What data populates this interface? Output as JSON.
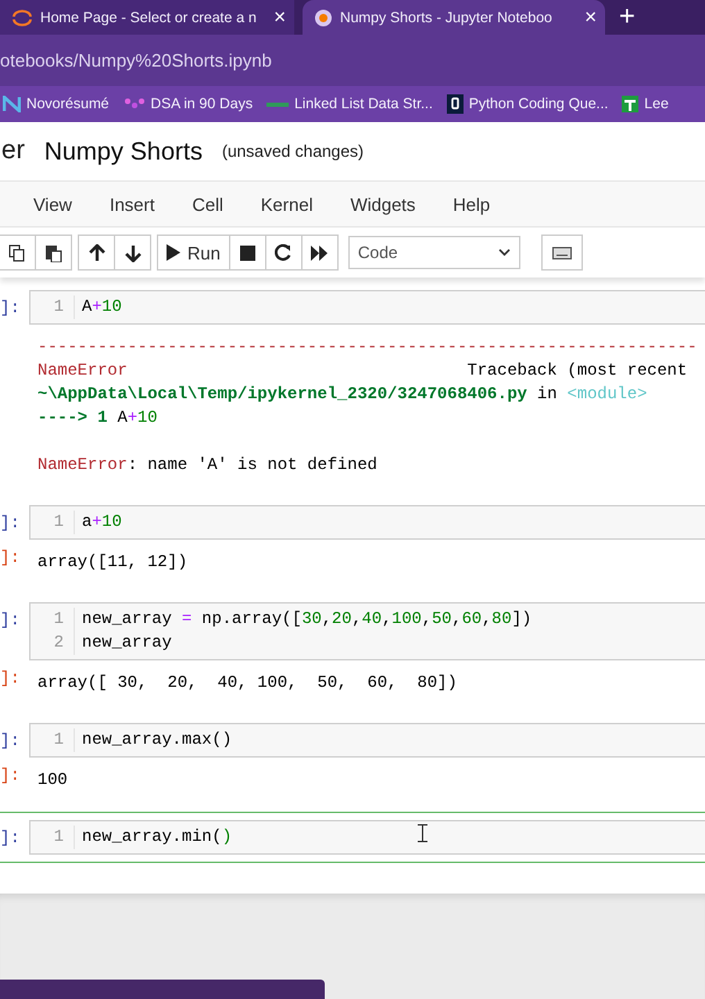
{
  "browser": {
    "tabs": [
      {
        "title": "Home Page - Select or create a n",
        "selected": false,
        "close": "×"
      },
      {
        "title": "Numpy Shorts - Jupyter Noteboo",
        "selected": true,
        "close": "×"
      }
    ],
    "new_tab": "+",
    "address": "otebooks/Numpy%20Shorts.ipynb",
    "bookmarks": [
      {
        "label": "Novorésumé",
        "kind": "n"
      },
      {
        "label": "DSA in 90 Days",
        "kind": "dots"
      },
      {
        "label": "Linked List Data Str...",
        "kind": "line"
      },
      {
        "label": "Python Coding Que...",
        "kind": "q"
      },
      {
        "label": "Lee",
        "kind": "plus"
      }
    ]
  },
  "notebook": {
    "logo_fragment": "er",
    "title": "Numpy Shorts",
    "status": "(unsaved changes)",
    "menu": [
      "View",
      "Insert",
      "Cell",
      "Kernel",
      "Widgets",
      "Help"
    ],
    "toolbar": {
      "run": "Run",
      "cell_type": "Code"
    },
    "cells": [
      {
        "prompt": "]:",
        "selected": false,
        "lines": [
          {
            "number": "1",
            "tokens": [
              {
                "text": "A",
                "kind": "plain"
              },
              {
                "text": "+",
                "kind": "op"
              },
              {
                "text": "10",
                "kind": "num"
              }
            ]
          }
        ],
        "output": [
          [
            {
              "text": "------------------------------------------------------------------",
              "kind": "err"
            }
          ],
          [
            {
              "text": "NameError",
              "kind": "err"
            },
            {
              "text": "                                  Traceback (most recent",
              "kind": "plain"
            }
          ],
          [
            {
              "text": "~\\AppData\\Local\\Temp/ipykernel_2320/3247068406.py",
              "kind": "path"
            },
            {
              "text": " in ",
              "kind": "plain"
            },
            {
              "text": "<module>",
              "kind": "mod"
            }
          ],
          [
            {
              "text": "----> 1 ",
              "kind": "path"
            },
            {
              "text": "A",
              "kind": "plain"
            },
            {
              "text": "+",
              "kind": "op"
            },
            {
              "text": "10",
              "kind": "num"
            }
          ],
          [
            {
              "text": "NameError",
              "kind": "err",
              "gap_before": true
            },
            {
              "text": ": name 'A' is not defined",
              "kind": "plain"
            }
          ]
        ]
      },
      {
        "prompt": "]:",
        "selected": false,
        "lines": [
          {
            "number": "1",
            "tokens": [
              {
                "text": "a",
                "kind": "plain"
              },
              {
                "text": "+",
                "kind": "op"
              },
              {
                "text": "10",
                "kind": "num"
              }
            ]
          }
        ],
        "output_prompt": "]:",
        "output": [
          [
            {
              "text": "array([11, 12])",
              "kind": "plain"
            }
          ]
        ]
      },
      {
        "prompt": "]:",
        "selected": false,
        "lines": [
          {
            "number": "1",
            "tokens": [
              {
                "text": "new_array ",
                "kind": "plain"
              },
              {
                "text": "=",
                "kind": "op"
              },
              {
                "text": " np.array([",
                "kind": "plain"
              },
              {
                "text": "30",
                "kind": "num"
              },
              {
                "text": ",",
                "kind": "plain"
              },
              {
                "text": "20",
                "kind": "num"
              },
              {
                "text": ",",
                "kind": "plain"
              },
              {
                "text": "40",
                "kind": "num"
              },
              {
                "text": ",",
                "kind": "plain"
              },
              {
                "text": "100",
                "kind": "num"
              },
              {
                "text": ",",
                "kind": "plain"
              },
              {
                "text": "50",
                "kind": "num"
              },
              {
                "text": ",",
                "kind": "plain"
              },
              {
                "text": "60",
                "kind": "num"
              },
              {
                "text": ",",
                "kind": "plain"
              },
              {
                "text": "80",
                "kind": "num"
              },
              {
                "text": "])",
                "kind": "plain"
              }
            ]
          },
          {
            "number": "2",
            "tokens": [
              {
                "text": "new_array",
                "kind": "plain"
              }
            ]
          }
        ],
        "output_prompt": "]:",
        "output": [
          [
            {
              "text": "array([ 30,  20,  40, 100,  50,  60,  80])",
              "kind": "plain"
            }
          ]
        ]
      },
      {
        "prompt": "]:",
        "selected": false,
        "lines": [
          {
            "number": "1",
            "tokens": [
              {
                "text": "new_array.max()",
                "kind": "plain"
              }
            ]
          }
        ],
        "output_prompt": "]:",
        "output": [
          [
            {
              "text": "100",
              "kind": "plain"
            }
          ]
        ]
      },
      {
        "prompt": "]:",
        "selected": true,
        "lines": [
          {
            "number": "1",
            "tokens": [
              {
                "text": "new_array.min(",
                "kind": "plain"
              },
              {
                "text": ")",
                "kind": "num"
              }
            ]
          }
        ]
      }
    ]
  }
}
